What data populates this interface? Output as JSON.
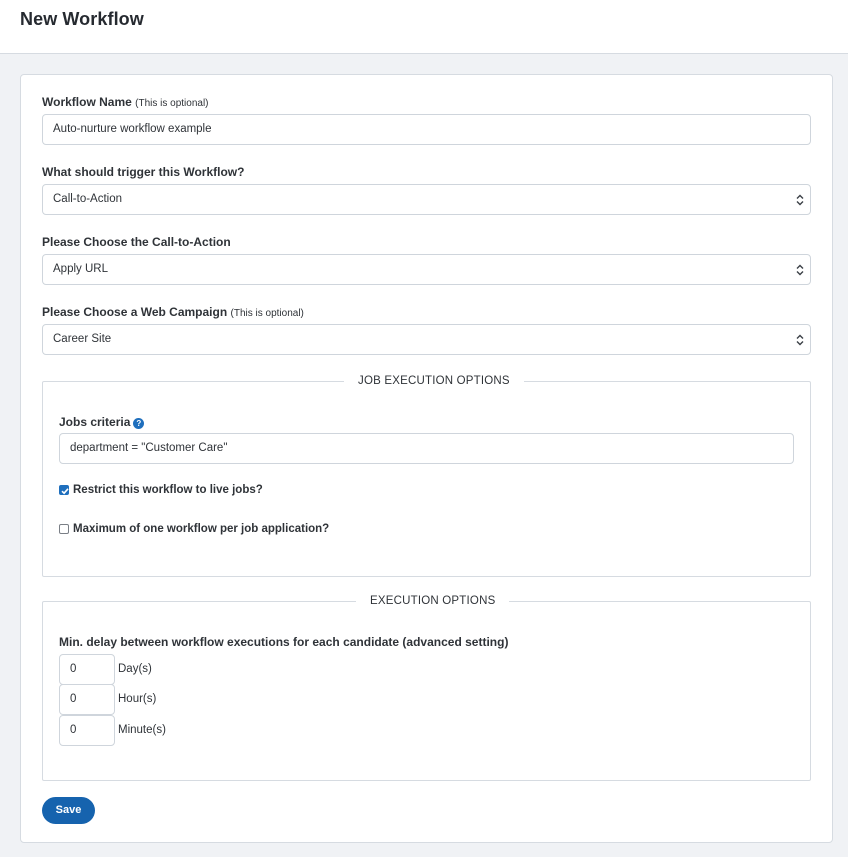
{
  "header": {
    "title": "New Workflow"
  },
  "form": {
    "workflow_name": {
      "label": "Workflow Name",
      "optional_note": "(This is optional)",
      "value": "Auto-nurture workflow example"
    },
    "trigger": {
      "label": "What should trigger this Workflow?",
      "value": "Call-to-Action"
    },
    "call_to_action": {
      "label": "Please Choose the Call-to-Action",
      "value": "Apply URL"
    },
    "web_campaign": {
      "label": "Please Choose a Web Campaign",
      "optional_note": "(This is optional)",
      "value": "Career Site"
    }
  },
  "job_execution": {
    "legend": "JOB EXECUTION OPTIONS",
    "jobs_criteria_label": "Jobs criteria",
    "help_icon": "question-circle-icon",
    "help_glyph": "?",
    "jobs_criteria_value": "department = \"Customer Care\"",
    "restrict_live": {
      "label": "Restrict this workflow to live jobs?",
      "checked": true
    },
    "max_one": {
      "label": "Maximum of one workflow per job application?",
      "checked": false
    }
  },
  "execution": {
    "legend": "EXECUTION OPTIONS",
    "delay_label": "Min. delay between workflow executions for each candidate (advanced setting)",
    "days": {
      "value": "0",
      "unit": "Day(s)"
    },
    "hours": {
      "value": "0",
      "unit": "Hour(s)"
    },
    "minutes": {
      "value": "0",
      "unit": "Minute(s)"
    }
  },
  "actions": {
    "save_label": "Save"
  },
  "colors": {
    "accent": "#1663ae",
    "help": "#1f6fbd",
    "page_bg": "#f0f2f5"
  }
}
